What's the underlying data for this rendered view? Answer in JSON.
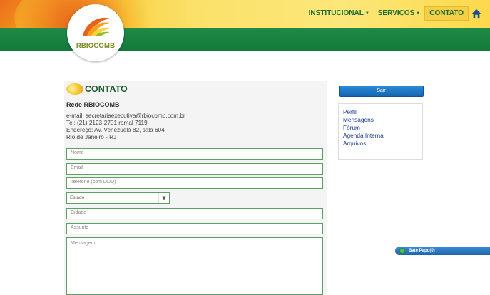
{
  "header": {
    "logo_text": "RBIOCOMB",
    "nav": [
      {
        "label": "INSTITUCIONAL",
        "has_dropdown": true,
        "active": false
      },
      {
        "label": "SERVIÇOS",
        "has_dropdown": true,
        "active": false
      },
      {
        "label": "CONTATO",
        "has_dropdown": false,
        "active": true
      }
    ],
    "home_icon": "home-icon"
  },
  "main": {
    "title": "CONTATO",
    "org_name": "Rede RBIOCOMB",
    "contact_lines": [
      "e-mail: secretariaexecutiva@rbiocomb.com.br",
      "Tel: (21) 2123-2701 ramal 7119",
      "Endereço: Av. Venezuela 82, sala 604",
      "Rio de Janeiro - RJ"
    ],
    "form": {
      "name_placeholder": "Nome",
      "email_placeholder": "Email",
      "phone_placeholder": "Telefone (com DDD)",
      "state_selected": "Estado",
      "city_placeholder": "Cidade",
      "subject_placeholder": "Assunto",
      "message_placeholder": "Mensagem"
    }
  },
  "sidebar": {
    "logout_label": "Sair",
    "links": [
      "Perfil",
      "Mensagens",
      "Fórum",
      "Agenda Interna",
      "Arquivos"
    ]
  },
  "chat": {
    "label": "Bate Papo(0)"
  },
  "colors": {
    "brand_green": "#137a3b",
    "nav_active": "#f5cf45",
    "field_border": "#5da065",
    "link_blue": "#1b3f8f",
    "button_blue": "#1566b0"
  }
}
